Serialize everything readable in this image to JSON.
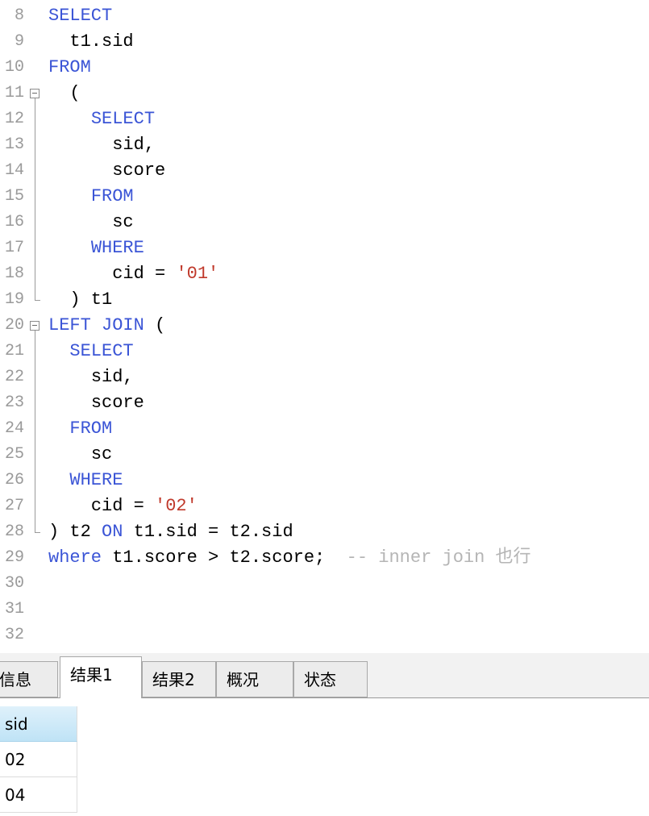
{
  "editor": {
    "line_numbers": [
      "8",
      "9",
      "10",
      "11",
      "12",
      "13",
      "14",
      "15",
      "16",
      "17",
      "18",
      "19",
      "20",
      "21",
      "22",
      "23",
      "24",
      "25",
      "26",
      "27",
      "28",
      "29",
      "30",
      "31",
      "32"
    ],
    "lines": [
      {
        "indent": "",
        "tokens": [
          {
            "text": "SELECT",
            "type": "kw"
          }
        ]
      },
      {
        "indent": "  ",
        "tokens": [
          {
            "text": "t1.sid",
            "type": "plain"
          }
        ]
      },
      {
        "indent": "",
        "tokens": [
          {
            "text": "FROM",
            "type": "kw"
          }
        ]
      },
      {
        "indent": "  ",
        "tokens": [
          {
            "text": "(",
            "type": "plain"
          }
        ]
      },
      {
        "indent": "    ",
        "tokens": [
          {
            "text": "SELECT",
            "type": "kw"
          }
        ]
      },
      {
        "indent": "      ",
        "tokens": [
          {
            "text": "sid,",
            "type": "plain"
          }
        ]
      },
      {
        "indent": "      ",
        "tokens": [
          {
            "text": "score",
            "type": "plain"
          }
        ]
      },
      {
        "indent": "    ",
        "tokens": [
          {
            "text": "FROM",
            "type": "kw"
          }
        ]
      },
      {
        "indent": "      ",
        "tokens": [
          {
            "text": "sc",
            "type": "plain"
          }
        ]
      },
      {
        "indent": "    ",
        "tokens": [
          {
            "text": "WHERE",
            "type": "kw"
          }
        ]
      },
      {
        "indent": "      ",
        "tokens": [
          {
            "text": "cid = ",
            "type": "plain"
          },
          {
            "text": "'01'",
            "type": "str"
          }
        ]
      },
      {
        "indent": "  ",
        "tokens": [
          {
            "text": ") t1",
            "type": "plain"
          }
        ]
      },
      {
        "indent": "",
        "tokens": [
          {
            "text": "LEFT JOIN",
            "type": "kw"
          },
          {
            "text": " (",
            "type": "plain"
          }
        ]
      },
      {
        "indent": "  ",
        "tokens": [
          {
            "text": "SELECT",
            "type": "kw"
          }
        ]
      },
      {
        "indent": "    ",
        "tokens": [
          {
            "text": "sid,",
            "type": "plain"
          }
        ]
      },
      {
        "indent": "    ",
        "tokens": [
          {
            "text": "score",
            "type": "plain"
          }
        ]
      },
      {
        "indent": "  ",
        "tokens": [
          {
            "text": "FROM",
            "type": "kw"
          }
        ]
      },
      {
        "indent": "    ",
        "tokens": [
          {
            "text": "sc",
            "type": "plain"
          }
        ]
      },
      {
        "indent": "  ",
        "tokens": [
          {
            "text": "WHERE",
            "type": "kw"
          }
        ]
      },
      {
        "indent": "    ",
        "tokens": [
          {
            "text": "cid = ",
            "type": "plain"
          },
          {
            "text": "'02'",
            "type": "str"
          }
        ]
      },
      {
        "indent": "",
        "tokens": [
          {
            "text": ") t2 ",
            "type": "plain"
          },
          {
            "text": "ON",
            "type": "kw"
          },
          {
            "text": " t1.sid = t2.sid",
            "type": "plain"
          }
        ]
      },
      {
        "indent": "",
        "tokens": [
          {
            "text": "where",
            "type": "kw"
          },
          {
            "text": " t1.score > t2.score;  ",
            "type": "plain"
          },
          {
            "text": "-- inner join 也行",
            "type": "cm"
          }
        ]
      },
      {
        "indent": "",
        "tokens": []
      },
      {
        "indent": "",
        "tokens": []
      },
      {
        "indent": "",
        "tokens": []
      }
    ],
    "colors": {
      "keyword": "#3b55d6",
      "string": "#c0392b",
      "comment": "#b5b5b5",
      "line_number": "#9a9a9a"
    }
  },
  "result_tabs": [
    {
      "label": "信息",
      "active": false
    },
    {
      "label": "结果1",
      "active": true
    },
    {
      "label": "结果2",
      "active": false
    },
    {
      "label": "概况",
      "active": false
    },
    {
      "label": "状态",
      "active": false
    }
  ],
  "result_grid": {
    "column_header": "sid",
    "rows": [
      "02",
      "04"
    ]
  }
}
